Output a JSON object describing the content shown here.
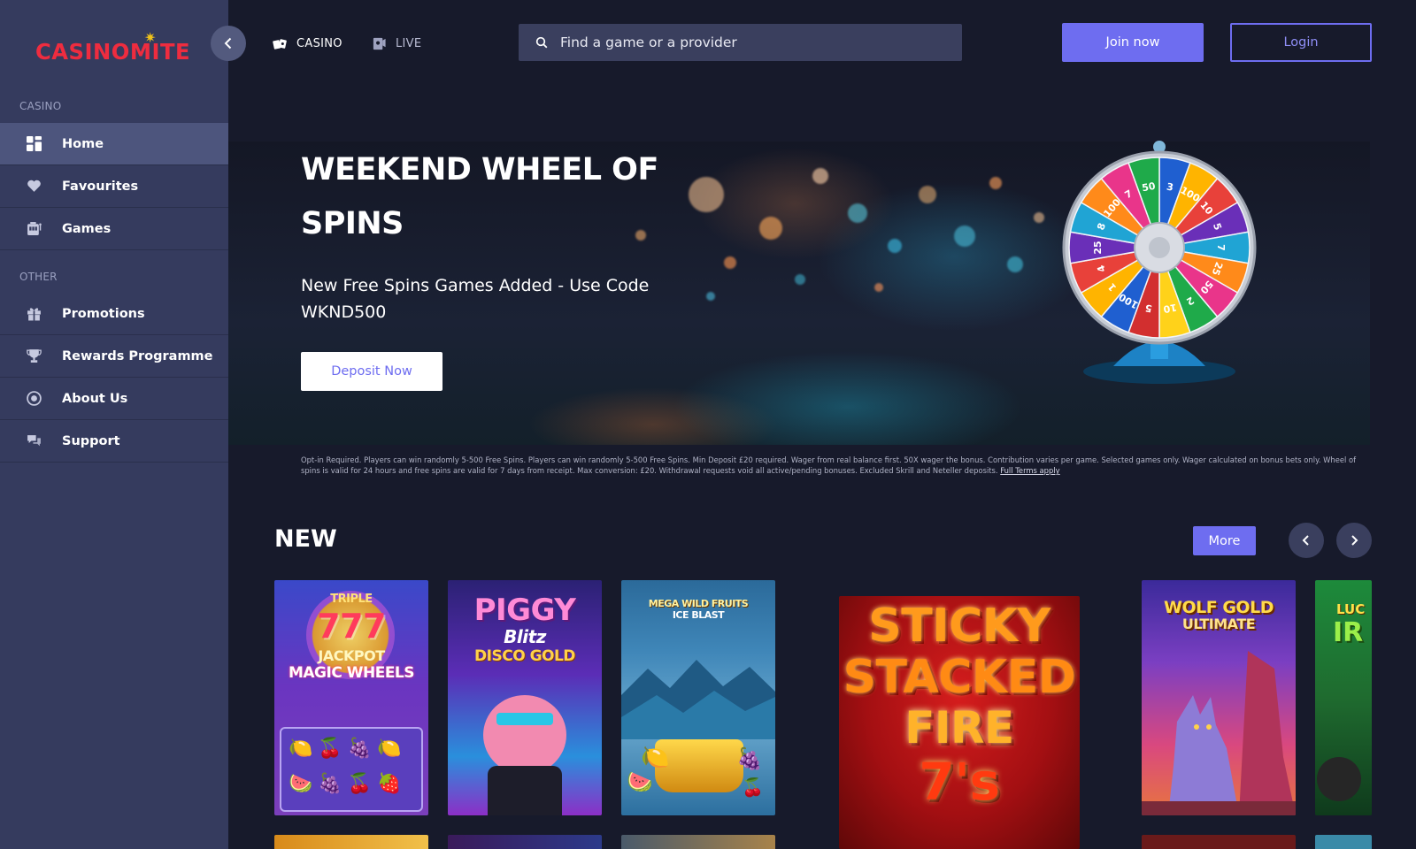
{
  "brand": {
    "logo_text": "CASINOMITE",
    "logo_color": "#ee2c3f",
    "accent": "#6e6df0",
    "sidebar_bg": "#353b5e",
    "page_bg": "#171a2b"
  },
  "sidebar": {
    "collapse_icon": "chevron-left-icon",
    "section_casino": "CASINO",
    "section_other": "OTHER",
    "casino_items": [
      {
        "label": "Home",
        "icon": "grid-icon",
        "active": true
      },
      {
        "label": "Favourites",
        "icon": "heart-icon"
      },
      {
        "label": "Games",
        "icon": "slot-machine-icon"
      }
    ],
    "other_items": [
      {
        "label": "Promotions",
        "icon": "gift-icon"
      },
      {
        "label": "Rewards Programme",
        "icon": "trophy-icon"
      },
      {
        "label": "About Us",
        "icon": "info-circle-icon"
      },
      {
        "label": "Support",
        "icon": "chat-bubbles-icon"
      }
    ]
  },
  "header": {
    "tabs": [
      {
        "label": "CASINO",
        "icon": "cards-icon"
      },
      {
        "label": "LIVE",
        "icon": "live-dealer-icon"
      }
    ],
    "search_placeholder": "Find a game or a provider",
    "join_label": "Join now",
    "login_label": "Login"
  },
  "banner": {
    "title": "WEEKEND WHEEL OF SPINS",
    "subtitle": "New Free Spins Games Added - Use Code WKND500",
    "cta_label": "Deposit Now",
    "terms": "Opt-in Required. Players can win randomly 5-500 Free Spins. Players can win randomly 5-500 Free Spins. Min Deposit £20 required. Wager from real balance first. 50X wager the bonus. Contribution varies per game. Selected games only. Wager calculated on bonus bets only. Wheel of spins is valid for 24 hours and free spins are valid for 7 days from receipt. Max conversion: £20. Withdrawal requests void all active/pending bonuses. Excluded Skrill and Neteller deposits.",
    "terms_link": "Full Terms apply",
    "wheel_labels": [
      "3",
      "100",
      "10",
      "5",
      "7",
      "25",
      "50",
      "2",
      "10",
      "5",
      "100",
      "1",
      "4",
      "25",
      "8",
      "100",
      "7",
      "50"
    ]
  },
  "new_section": {
    "title": "NEW",
    "more_label": "More",
    "prev_icon": "chevron-left-icon",
    "next_icon": "chevron-right-icon",
    "games": [
      {
        "title": "TRIPLE 777 JACKPOT MAGIC WHEELS",
        "line1": "TRIPLE",
        "line2": "777",
        "line3": "JACKPOT",
        "line4": "MAGIC WHEELS"
      },
      {
        "title": "PIGGY Blitz DISCO GOLD",
        "line1": "PIGGY",
        "line2": "Blitz",
        "line3": "DISCO GOLD"
      },
      {
        "title": "MEGA WILD FRUITS ICE BLAST",
        "line1": "MEGA WILD FRUITS",
        "line2": "ICE BLAST"
      },
      {
        "title": "STICKY STACKED FIRE 7's",
        "line1": "STICKY",
        "line2": "STACKED",
        "line3": "FIRE",
        "line4": "7's"
      },
      {
        "title": "WOLF GOLD ULTIMATE",
        "line1": "WOLF GOLD",
        "line2": "ULTIMATE"
      },
      {
        "title": "LUC",
        "line1": "LUC",
        "line2": "IR"
      }
    ]
  }
}
